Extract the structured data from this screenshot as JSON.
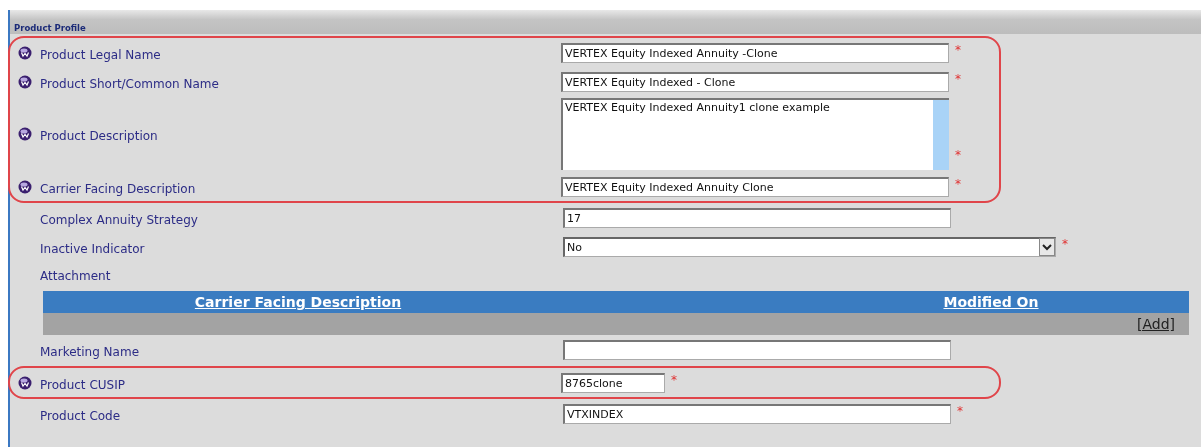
{
  "section": {
    "title": "Product Profile"
  },
  "fields": [
    {
      "kind": "text",
      "label": "Product Legal Name",
      "value": "VERTEX Equity Indexed Annuity -Clone",
      "required_mark": "*",
      "info_icon": true,
      "highlighted": true
    },
    {
      "kind": "text",
      "label": "Product Short/Common Name",
      "value": "VERTEX Equity Indexed - Clone",
      "required_mark": "*",
      "info_icon": true,
      "highlighted": true
    },
    {
      "kind": "textarea",
      "label": "Product Description",
      "value": "VERTEX Equity Indexed Annuity1 clone example",
      "required_mark": "*",
      "info_icon": true,
      "highlighted": true
    },
    {
      "kind": "text",
      "label": "Carrier Facing Description",
      "value": "VERTEX Equity Indexed Annuity Clone",
      "required_mark": "*",
      "info_icon": true,
      "highlighted": true
    },
    {
      "kind": "text",
      "label": "Complex Annuity Strategy",
      "value": "17",
      "info_icon": false,
      "highlighted": false
    },
    {
      "kind": "select",
      "label": "Inactive Indicator",
      "value": "No",
      "required_mark": "*",
      "info_icon": false,
      "highlighted": false
    },
    {
      "kind": "attachment",
      "label": "Attachment",
      "columns": [
        "Carrier Facing Description",
        "Modified On"
      ],
      "add_link": "[Add]",
      "info_icon": false,
      "highlighted": false
    },
    {
      "kind": "text",
      "label": "Marketing Name",
      "info_icon": false,
      "highlighted": false
    },
    {
      "kind": "short",
      "label": "Product CUSIP",
      "value": "8765clone",
      "required_mark": "*",
      "info_icon": true,
      "highlighted": true
    },
    {
      "kind": "text",
      "label": "Product Code",
      "value": "VTXINDEX",
      "required_mark": "*",
      "info_icon": false,
      "highlighted": false
    }
  ]
}
